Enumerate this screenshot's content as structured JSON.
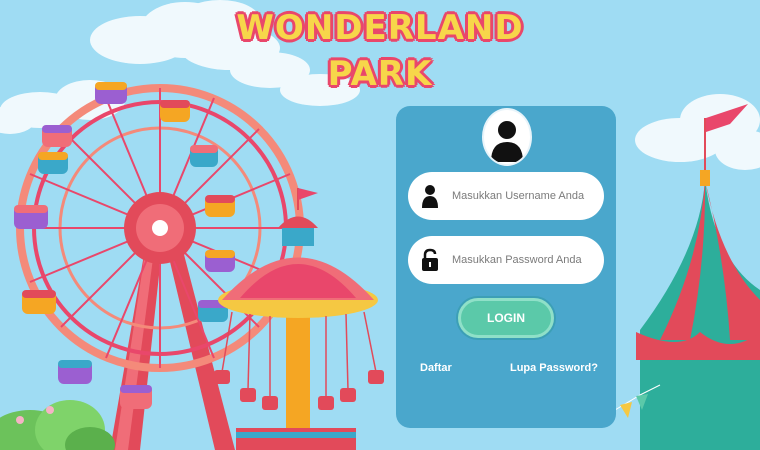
{
  "header": {
    "title_line1": "WONDERLAND",
    "title_line2": "PARK"
  },
  "login_form": {
    "username_placeholder": "Masukkan Username Anda",
    "password_placeholder": "Masukkan Password Anda",
    "login_label": "LOGIN",
    "register_label": "Daftar",
    "forgot_label": "Lupa Password?"
  },
  "icons": {
    "avatar": "user-avatar-icon",
    "username": "person-icon",
    "password": "padlock-icon"
  },
  "colors": {
    "sky": "#9fdcf3",
    "panel": "#4aa7cc",
    "login_button": "#5bc9a9",
    "title_fill": "#f7d64a",
    "title_outline": "#e9476b"
  }
}
